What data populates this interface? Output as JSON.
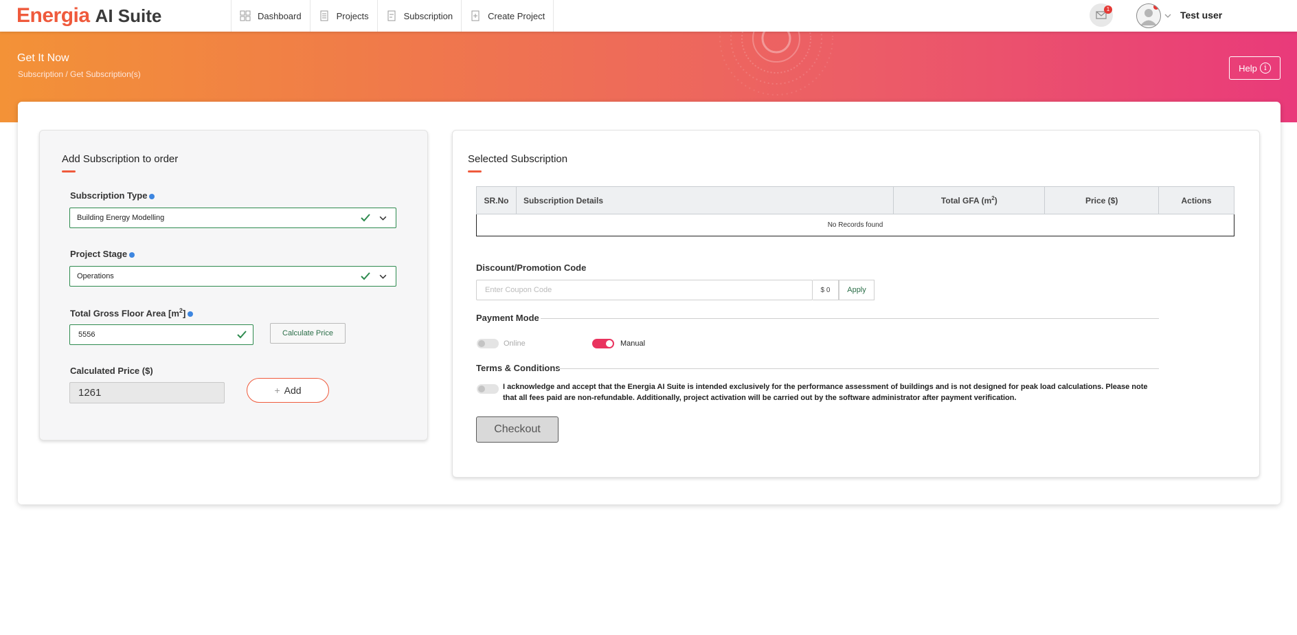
{
  "app": {
    "logo_main": "Energia",
    "logo_sub": "AI Suite"
  },
  "nav": {
    "items": [
      {
        "label": "Dashboard",
        "icon": "dashboard-icon"
      },
      {
        "label": "Projects",
        "icon": "projects-icon"
      },
      {
        "label": "Subscription",
        "icon": "subscription-icon"
      },
      {
        "label": "Create Project",
        "icon": "create-project-icon"
      }
    ],
    "notification_count": "1",
    "user_name": "Test user"
  },
  "banner": {
    "title": "Get It Now",
    "breadcrumb": "Subscription / Get Subscription(s)",
    "help_label": "Help"
  },
  "add_panel": {
    "title": "Add Subscription to order",
    "subscription_type_label": "Subscription Type",
    "subscription_type_value": "Building Energy Modelling",
    "project_stage_label": "Project Stage",
    "project_stage_value": "Operations",
    "gfa_label": "Total Gross Floor Area [m",
    "gfa_sup": "2",
    "gfa_label_end": "]",
    "gfa_value": "5556",
    "calculate_label": "Calculate Price",
    "calculated_price_label": "Calculated Price ($)",
    "calculated_price_value": "1261",
    "add_label": "Add"
  },
  "selected_panel": {
    "title": "Selected Subscription",
    "table": {
      "headers": [
        "SR.No",
        "Subscription Details",
        "Total GFA (m",
        "Price ($)",
        "Actions"
      ],
      "gfa_sup": "2",
      "gfa_end": ")",
      "empty_message": "No Records found"
    },
    "coupon_label": "Discount/Promotion Code",
    "coupon_placeholder": "Enter Coupon Code",
    "coupon_amount": "$ 0",
    "apply_label": "Apply",
    "payment_mode_label": "Payment Mode",
    "payment_online_label": "Online",
    "payment_manual_label": "Manual",
    "payment_online_on": false,
    "payment_manual_on": true,
    "terms_label": "Terms & Conditions",
    "terms_text": "I acknowledge and accept that the Energia AI Suite is intended exclusively for the performance assessment of buildings and is not designed for peak load calculations. Please note that all fees paid are non-refundable. Additionally, project activation will be carried out by the software administrator after payment verification.",
    "terms_accepted": false,
    "checkout_label": "Checkout"
  },
  "colors": {
    "accent": "#ef5a3c",
    "success": "#2d8a4e",
    "toggle_on": "#e9335e",
    "banner_start": "#f39237",
    "banner_end": "#e93a7a"
  }
}
